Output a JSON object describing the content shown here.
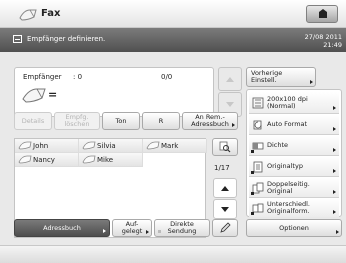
{
  "app": {
    "title": "Fax"
  },
  "status": {
    "message": "Empfänger definieren.",
    "date": "27/08 2011",
    "time": "21:49"
  },
  "recipient": {
    "label": "Empfänger",
    "count": ": 0",
    "fraction": "0/0",
    "value": "="
  },
  "buttons": {
    "details": "Details",
    "delete_line1": "Empfg.",
    "delete_line2": "löschen",
    "ton": "Ton",
    "r": "R",
    "an_rem_line1": "An Rem.-",
    "an_rem_line2": "Adressbuch",
    "adressbuch": "Adressbuch",
    "aufgelegt_line1": "Auf-",
    "aufgelegt_line2": "gelegt",
    "direkte_line1": "Direkte",
    "direkte_line2": "Sendung",
    "vorherige_line1": "Vorherige",
    "vorherige_line2": "Einstell.",
    "optionen": "Optionen"
  },
  "contacts": [
    "John",
    "Silvia",
    "Mark",
    "Nancy",
    "Mike"
  ],
  "page_indicator": "1/17",
  "settings": [
    {
      "line1": "200x100 dpi",
      "line2": "(Normal)",
      "icon": "resolution-icon"
    },
    {
      "line1": "Auto Format",
      "line2": "",
      "icon": "auto-format-icon"
    },
    {
      "line1": "Dichte",
      "line2": "",
      "icon": "density-icon"
    },
    {
      "line1": "Originaltyp",
      "line2": "",
      "icon": "original-type-icon"
    },
    {
      "line1": "Doppelseitig.",
      "line2": "Original",
      "icon": "two-sided-icon"
    },
    {
      "line1": "Unterschiedl.",
      "line2": "Originalform.",
      "icon": "different-sizes-icon"
    }
  ]
}
